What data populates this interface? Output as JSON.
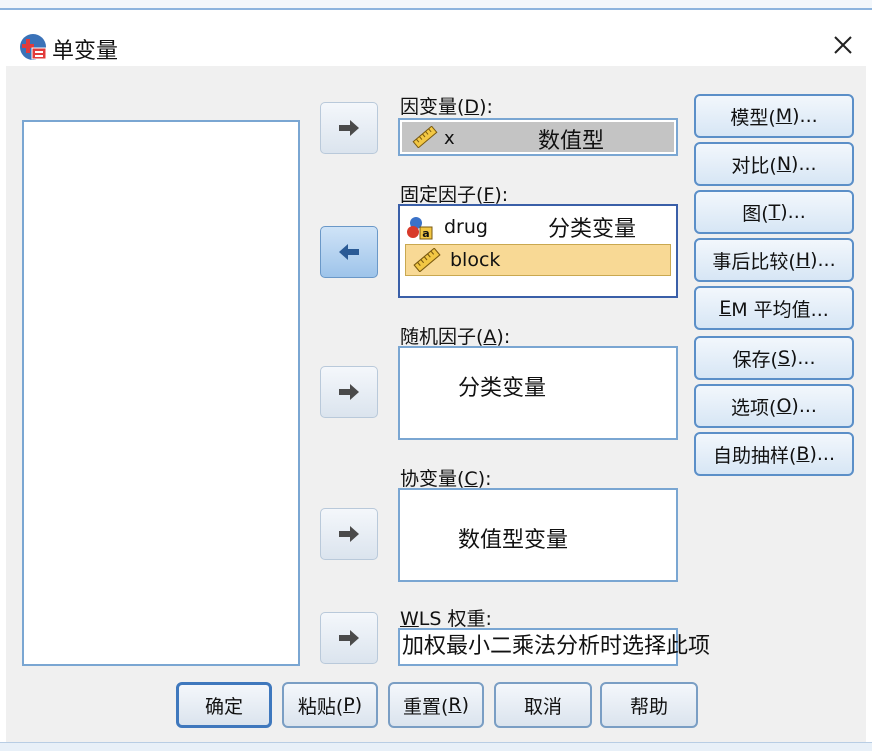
{
  "window": {
    "title": "单变量"
  },
  "dependent": {
    "label_main": "因变量(",
    "label_key": "D",
    "label_end": "):",
    "var_name": "x",
    "note": "数值型"
  },
  "fixed": {
    "label_main": "固定因子(",
    "label_key": "F",
    "label_end": "):",
    "items": [
      {
        "name": "drug",
        "note": "分类变量",
        "icon": "nominal-icon"
      },
      {
        "name": "block",
        "note": "",
        "icon": "scale-icon"
      }
    ]
  },
  "random": {
    "label_main": "随机因子(",
    "label_key": "A",
    "label_end": "):",
    "note": "分类变量"
  },
  "covariate": {
    "label_main": "协变量(",
    "label_key": "C",
    "label_end": "):",
    "note": "数值型变量"
  },
  "wls": {
    "label_key": "W",
    "label_rest": "LS 权重:",
    "note": "加权最小二乘法分析时选择此项"
  },
  "side_buttons": [
    {
      "pre": "模型(",
      "key": "M",
      "post": ")..."
    },
    {
      "pre": "对比(",
      "key": "N",
      "post": ")..."
    },
    {
      "pre": "图(",
      "key": "T",
      "post": ")..."
    },
    {
      "pre": "事后比较(",
      "key": "H",
      "post": ")..."
    },
    {
      "pre": "",
      "key": "E",
      "post": "M 平均值..."
    },
    {
      "pre": "保存(",
      "key": "S",
      "post": ")..."
    },
    {
      "pre": "选项(",
      "key": "O",
      "post": ")..."
    },
    {
      "pre": "自助抽样(",
      "key": "B",
      "post": ")..."
    }
  ],
  "bottom_buttons": [
    {
      "pre": "确定",
      "key": "",
      "post": ""
    },
    {
      "pre": "粘贴(",
      "key": "P",
      "post": ")"
    },
    {
      "pre": "重置(",
      "key": "R",
      "post": ")"
    },
    {
      "pre": "取消",
      "key": "",
      "post": ""
    },
    {
      "pre": "帮助",
      "key": "",
      "post": ""
    }
  ],
  "colors": {
    "selection": "#f8d995",
    "dependent_bg": "#c4c4c4",
    "accent": "#3f78bd"
  }
}
